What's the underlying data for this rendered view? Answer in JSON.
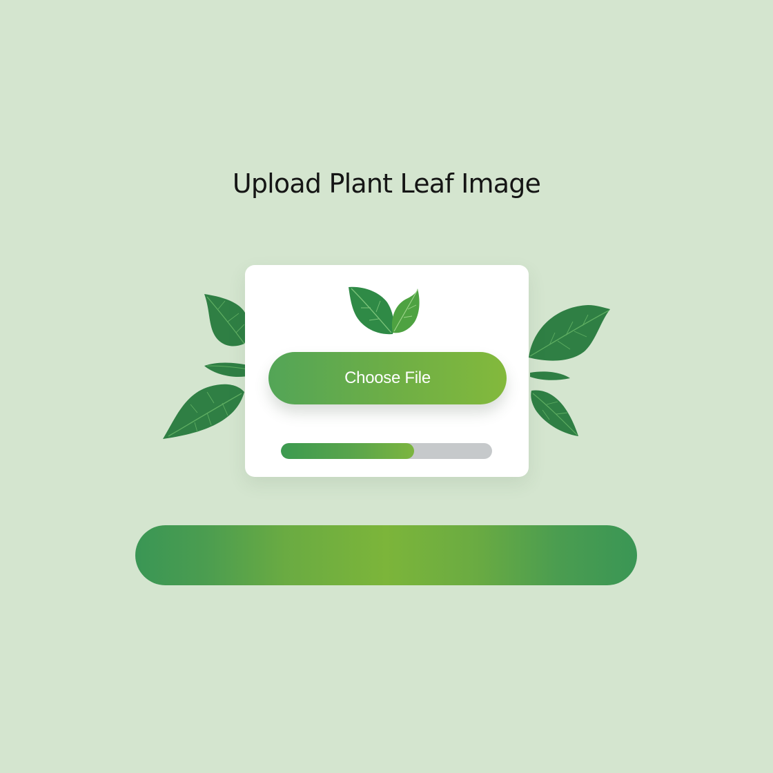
{
  "page": {
    "title": "Upload Plant Leaf Image"
  },
  "upload": {
    "button_label": "Choose File",
    "progress_fraction": 0.63
  },
  "bottom_bar": {
    "progress_fraction": 1.0
  },
  "icons": {
    "card_logo": "leaves-icon",
    "decor_left": "leaf-icon",
    "decor_right": "leaf-icon"
  },
  "colors": {
    "background": "#d4e5cf",
    "accent_green": "#5aa54b",
    "leaf_dark": "#2f7f44",
    "leaf_light": "#4ea241",
    "card": "#ffffff",
    "track": "#c6c9cb"
  }
}
